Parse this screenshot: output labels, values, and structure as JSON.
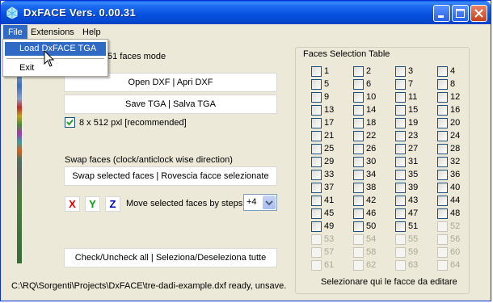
{
  "window": {
    "title": "DxFACE Vers. 0.00.31",
    "colors": {
      "titlebar": "#0650e0",
      "menu_highlight": "#316ac5",
      "face": "#ece9d8"
    }
  },
  "menubar": {
    "items": [
      "File",
      "Extensions",
      "Help"
    ]
  },
  "file_menu": {
    "items": [
      "Load DxFACE TGA",
      "Exit"
    ]
  },
  "mode_label": "51 faces mode",
  "buttons": {
    "open_dxf": "Open DXF  |  Apri DXF",
    "save_tga": "Save TGA  |  Salva TGA",
    "swap_faces": "Swap selected faces  |  Rovescia facce selezionate",
    "check_all": "Check/Uncheck all  |  Seleziona/Deseleziona tutte"
  },
  "size_option": {
    "label": "8 x 512  pxl  [recommended]",
    "checked": true
  },
  "swap_label": "Swap faces (clock/anticlock wise direction)",
  "axes": [
    {
      "label": "X",
      "color": "#e00000"
    },
    {
      "label": "Y",
      "color": "#00a000"
    },
    {
      "label": "Z",
      "color": "#0000c0"
    }
  ],
  "move_label": "Move selected faces by steps",
  "steps": {
    "selected": "+4"
  },
  "faces_table": {
    "title": "Faces Selection Table",
    "footer": "Selezionare qui le facce da editare",
    "enabled_count": 51,
    "faces": [
      "1",
      "2",
      "3",
      "4",
      "5",
      "6",
      "7",
      "8",
      "9",
      "10",
      "11",
      "12",
      "13",
      "14",
      "15",
      "16",
      "17",
      "18",
      "19",
      "20",
      "21",
      "22",
      "23",
      "24",
      "25",
      "26",
      "27",
      "28",
      "29",
      "30",
      "31",
      "32",
      "33",
      "34",
      "35",
      "36",
      "37",
      "38",
      "39",
      "40",
      "41",
      "42",
      "43",
      "44",
      "45",
      "46",
      "47",
      "48",
      "49",
      "50",
      "51",
      "52",
      "53",
      "54",
      "55",
      "56",
      "57",
      "58",
      "59",
      "60",
      "61",
      "62",
      "63",
      "64"
    ]
  },
  "status": "C:\\RQ\\Sorgenti\\Projects\\DxFACE\\tre-dadi-example.dxf ready, unsave."
}
